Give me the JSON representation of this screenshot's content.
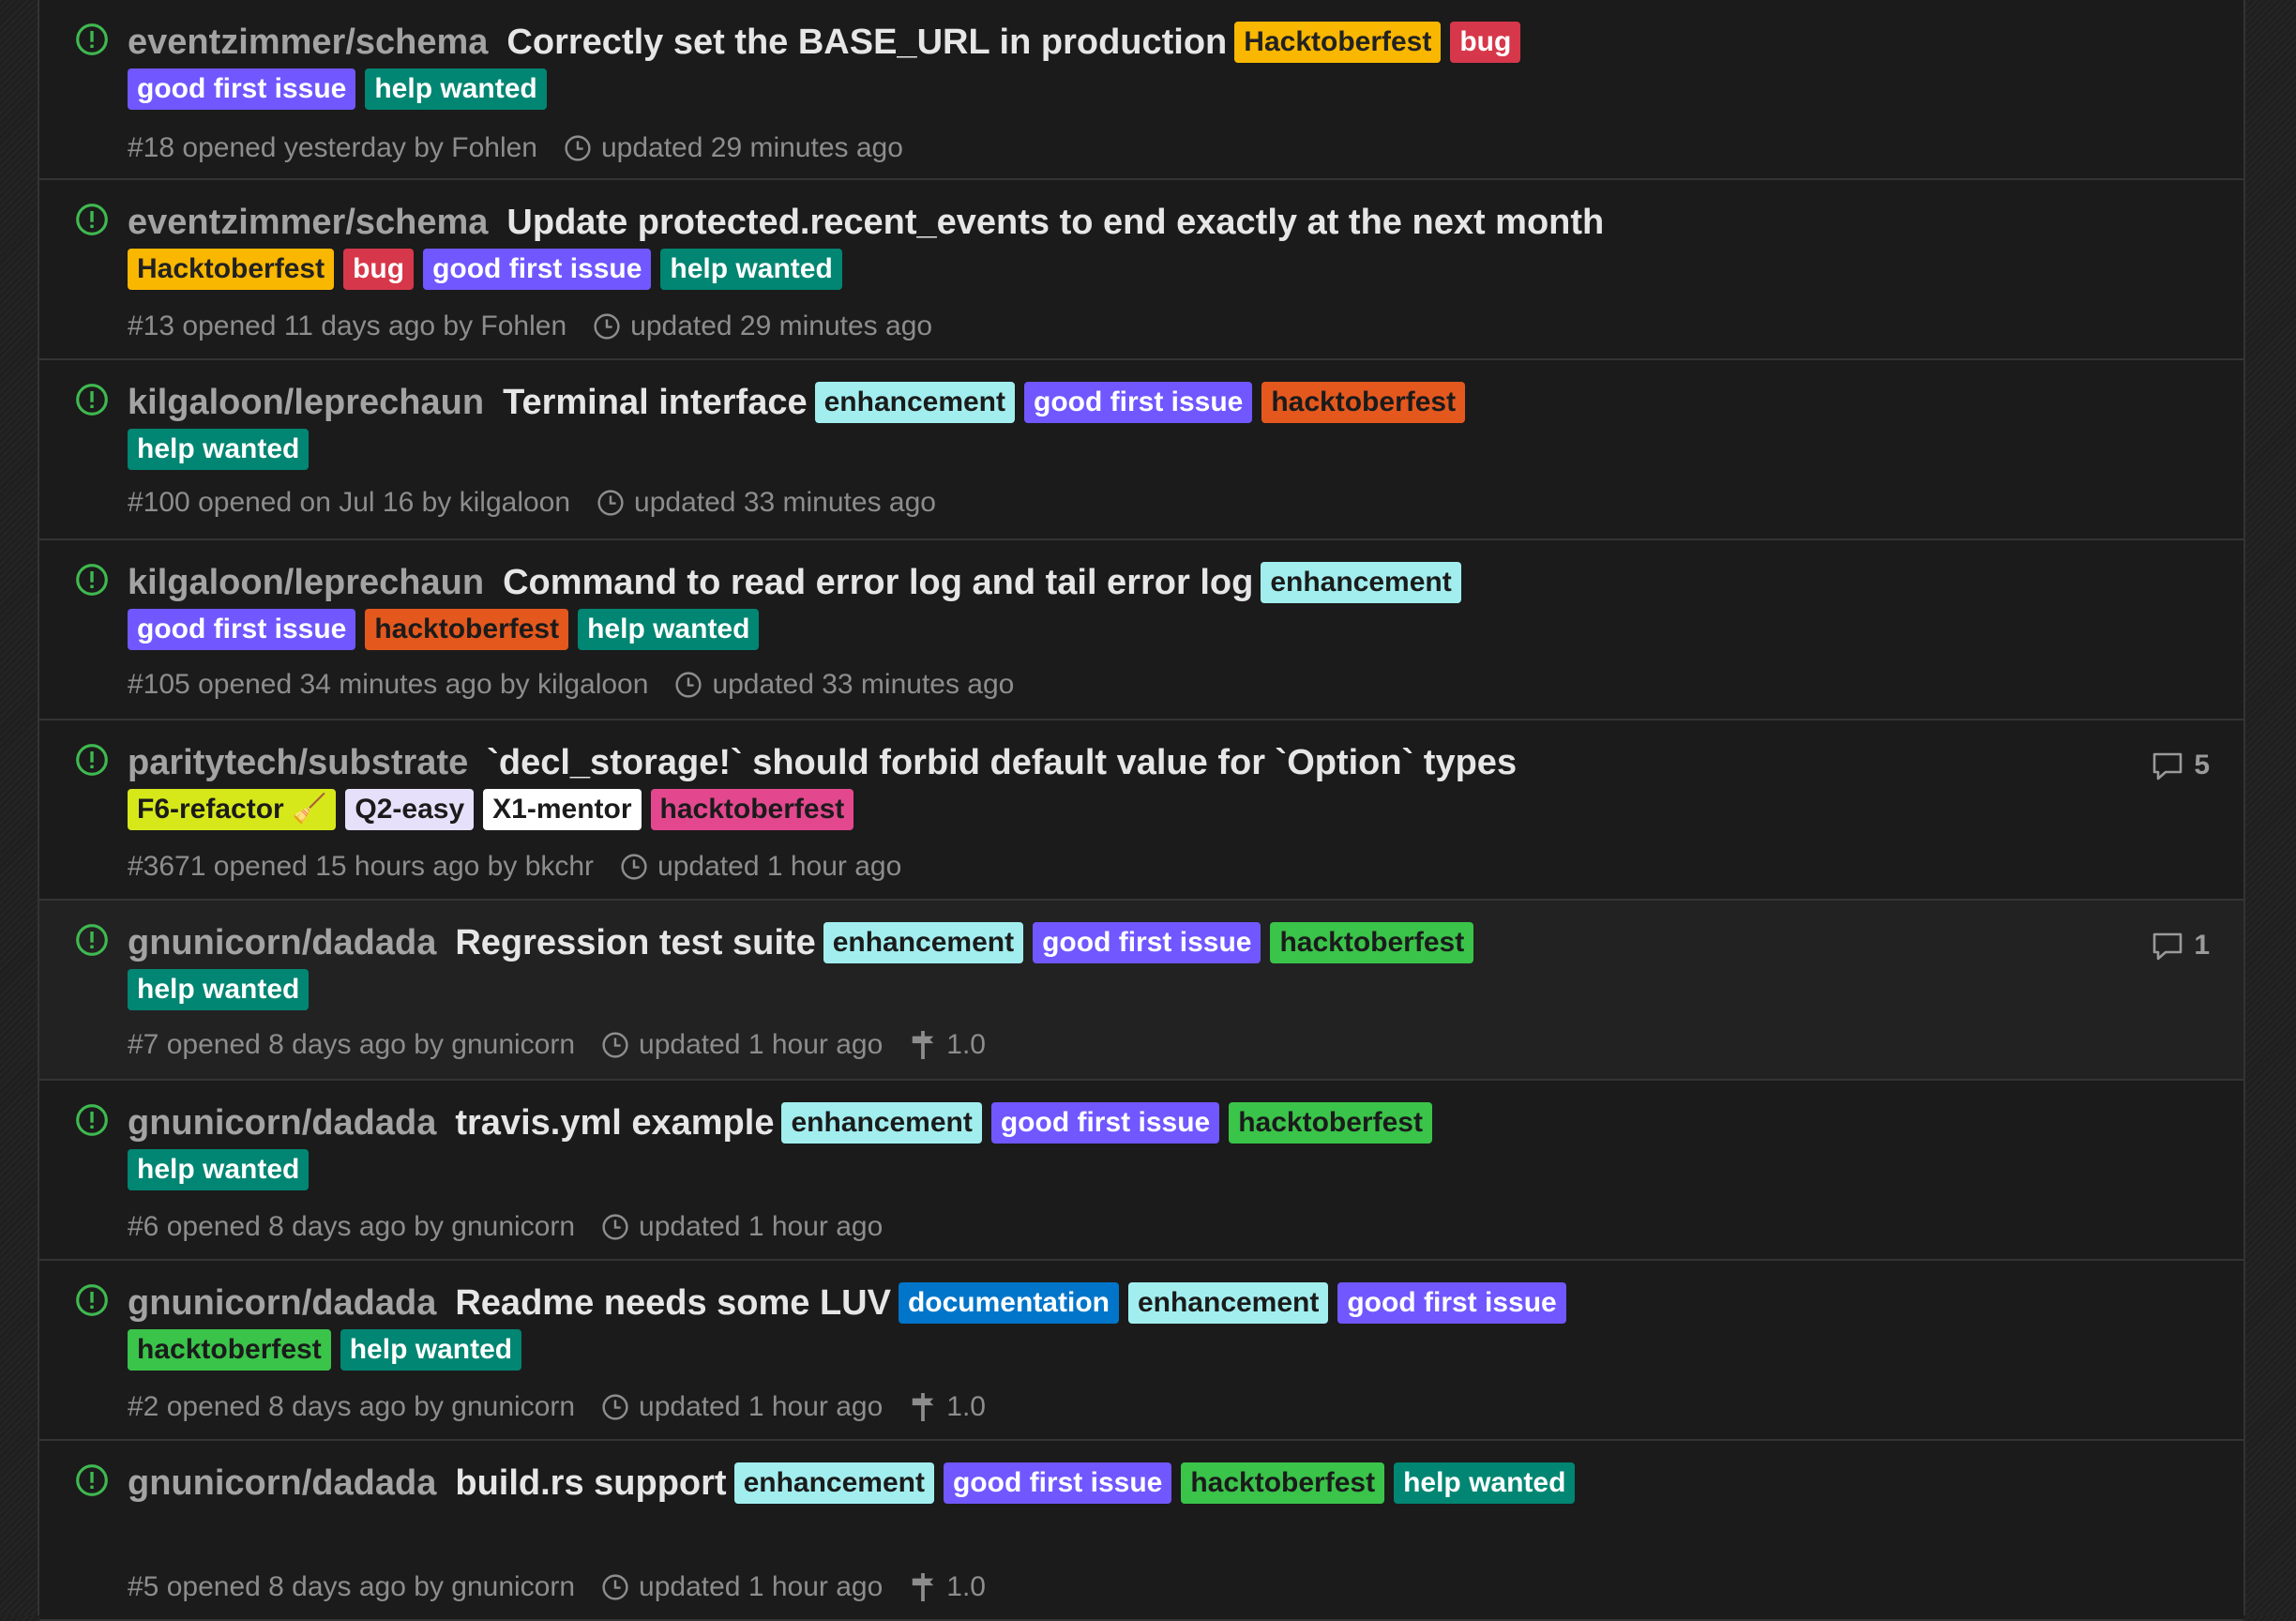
{
  "issues": [
    {
      "repo": "eventzimmer/schema",
      "title": "Correctly set the BASE_URL in production",
      "labels": [
        {
          "name": "Hacktoberfest",
          "bg": "#f9b700",
          "fg": "#222222"
        },
        {
          "name": "bug",
          "bg": "#d7374a",
          "fg": "#ffffff"
        },
        {
          "name": "good first issue",
          "bg": "#7057ff",
          "fg": "#ffffff"
        },
        {
          "name": "help wanted",
          "bg": "#008672",
          "fg": "#ffffff"
        }
      ],
      "meta": "#18 opened yesterday by Fohlen",
      "updated": "updated 29 minutes ago",
      "milestone": "",
      "comments": ""
    },
    {
      "repo": "eventzimmer/schema",
      "title": "Update protected.recent_events to end exactly at the next month",
      "labels": [
        {
          "name": "Hacktoberfest",
          "bg": "#f9b700",
          "fg": "#222222"
        },
        {
          "name": "bug",
          "bg": "#d7374a",
          "fg": "#ffffff"
        },
        {
          "name": "good first issue",
          "bg": "#7057ff",
          "fg": "#ffffff"
        },
        {
          "name": "help wanted",
          "bg": "#008672",
          "fg": "#ffffff"
        }
      ],
      "meta": "#13 opened 11 days ago by Fohlen",
      "updated": "updated 29 minutes ago",
      "milestone": "",
      "comments": ""
    },
    {
      "repo": "kilgaloon/leprechaun",
      "title": "Terminal interface",
      "labels": [
        {
          "name": "enhancement",
          "bg": "#a2eeef",
          "fg": "#1b1b1b"
        },
        {
          "name": "good first issue",
          "bg": "#7057ff",
          "fg": "#ffffff"
        },
        {
          "name": "hacktoberfest",
          "bg": "#e4581e",
          "fg": "#1b1b1b"
        },
        {
          "name": "help wanted",
          "bg": "#008672",
          "fg": "#ffffff"
        }
      ],
      "meta": "#100 opened on Jul 16 by kilgaloon",
      "updated": "updated 33 minutes ago",
      "milestone": "",
      "comments": ""
    },
    {
      "repo": "kilgaloon/leprechaun",
      "title": "Command to read error log and tail error log",
      "labels": [
        {
          "name": "enhancement",
          "bg": "#a2eeef",
          "fg": "#1b1b1b"
        },
        {
          "name": "good first issue",
          "bg": "#7057ff",
          "fg": "#ffffff"
        },
        {
          "name": "hacktoberfest",
          "bg": "#e4581e",
          "fg": "#1b1b1b"
        },
        {
          "name": "help wanted",
          "bg": "#008672",
          "fg": "#ffffff"
        }
      ],
      "meta": "#105 opened 34 minutes ago by kilgaloon",
      "updated": "updated 33 minutes ago",
      "milestone": "",
      "comments": ""
    },
    {
      "repo": "paritytech/substrate",
      "title": "`decl_storage!` should forbid default value for `Option` types",
      "labels": [
        {
          "name": "F6-refactor 🧹",
          "bg": "#d7e81a",
          "fg": "#1b1b1b"
        },
        {
          "name": "Q2-easy",
          "bg": "#e6e0fa",
          "fg": "#1b1b1b"
        },
        {
          "name": "X1-mentor",
          "bg": "#ffffff",
          "fg": "#1b1b1b"
        },
        {
          "name": "hacktoberfest",
          "bg": "#e3488f",
          "fg": "#1b1b1b"
        }
      ],
      "meta": "#3671 opened 15 hours ago by bkchr",
      "updated": "updated 1 hour ago",
      "milestone": "",
      "comments": "5"
    },
    {
      "repo": "gnunicorn/dadada",
      "title": "Regression test suite",
      "labels": [
        {
          "name": "enhancement",
          "bg": "#a2eeef",
          "fg": "#1b1b1b"
        },
        {
          "name": "good first issue",
          "bg": "#7057ff",
          "fg": "#ffffff"
        },
        {
          "name": "hacktoberfest",
          "bg": "#3ac44a",
          "fg": "#1b1b1b"
        },
        {
          "name": "help wanted",
          "bg": "#008672",
          "fg": "#ffffff"
        }
      ],
      "meta": "#7 opened 8 days ago by gnunicorn",
      "updated": "updated 1 hour ago",
      "milestone": "1.0",
      "comments": "1"
    },
    {
      "repo": "gnunicorn/dadada",
      "title": "travis.yml example",
      "labels": [
        {
          "name": "enhancement",
          "bg": "#a2eeef",
          "fg": "#1b1b1b"
        },
        {
          "name": "good first issue",
          "bg": "#7057ff",
          "fg": "#ffffff"
        },
        {
          "name": "hacktoberfest",
          "bg": "#3ac44a",
          "fg": "#1b1b1b"
        },
        {
          "name": "help wanted",
          "bg": "#008672",
          "fg": "#ffffff"
        }
      ],
      "meta": "#6 opened 8 days ago by gnunicorn",
      "updated": "updated 1 hour ago",
      "milestone": "",
      "comments": ""
    },
    {
      "repo": "gnunicorn/dadada",
      "title": "Readme needs some LUV",
      "labels": [
        {
          "name": "documentation",
          "bg": "#0075ca",
          "fg": "#ffffff"
        },
        {
          "name": "enhancement",
          "bg": "#a2eeef",
          "fg": "#1b1b1b"
        },
        {
          "name": "good first issue",
          "bg": "#7057ff",
          "fg": "#ffffff"
        },
        {
          "name": "hacktoberfest",
          "bg": "#3ac44a",
          "fg": "#1b1b1b"
        },
        {
          "name": "help wanted",
          "bg": "#008672",
          "fg": "#ffffff"
        }
      ],
      "meta": "#2 opened 8 days ago by gnunicorn",
      "updated": "updated 1 hour ago",
      "milestone": "1.0",
      "comments": ""
    },
    {
      "repo": "gnunicorn/dadada",
      "title": "build.rs support",
      "labels": [
        {
          "name": "enhancement",
          "bg": "#a2eeef",
          "fg": "#1b1b1b"
        },
        {
          "name": "good first issue",
          "bg": "#7057ff",
          "fg": "#ffffff"
        },
        {
          "name": "hacktoberfest",
          "bg": "#3ac44a",
          "fg": "#1b1b1b"
        },
        {
          "name": "help wanted",
          "bg": "#008672",
          "fg": "#ffffff"
        }
      ],
      "meta": "#5 opened 8 days ago by gnunicorn",
      "updated": "updated 1 hour ago",
      "milestone": "1.0",
      "comments": ""
    }
  ],
  "icons": {
    "status": "issue-opened-icon",
    "updated": "clock-icon",
    "milestone": "milestone-icon",
    "comments": "comment-icon"
  },
  "colors": {
    "open_status": "#3fb950"
  }
}
